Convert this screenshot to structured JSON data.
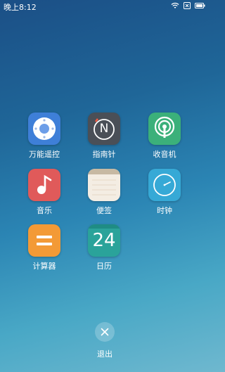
{
  "status_bar": {
    "time": "晚上8:12"
  },
  "apps": [
    {
      "label": "万能遥控",
      "icon": "remote-control-icon"
    },
    {
      "label": "指南针",
      "icon": "compass-icon"
    },
    {
      "label": "收音机",
      "icon": "radio-icon"
    },
    {
      "label": "音乐",
      "icon": "music-note-icon"
    },
    {
      "label": "便签",
      "icon": "notes-icon"
    },
    {
      "label": "时钟",
      "icon": "clock-icon"
    },
    {
      "label": "计算器",
      "icon": "calculator-icon"
    },
    {
      "label": "日历",
      "icon": "calendar-icon",
      "day": "24"
    }
  ],
  "compass_letter": "N",
  "exit": {
    "label": "退出",
    "icon": "close-icon"
  },
  "colors": {
    "remote": "#3e7fd8",
    "compass": "#4a4f57",
    "radio": "#3bb07a",
    "music": "#e05a5a",
    "notes": "#f4ede3",
    "clock": "#36a9d6",
    "calculator": "#f39a36",
    "calendar": "#2aa39a"
  }
}
